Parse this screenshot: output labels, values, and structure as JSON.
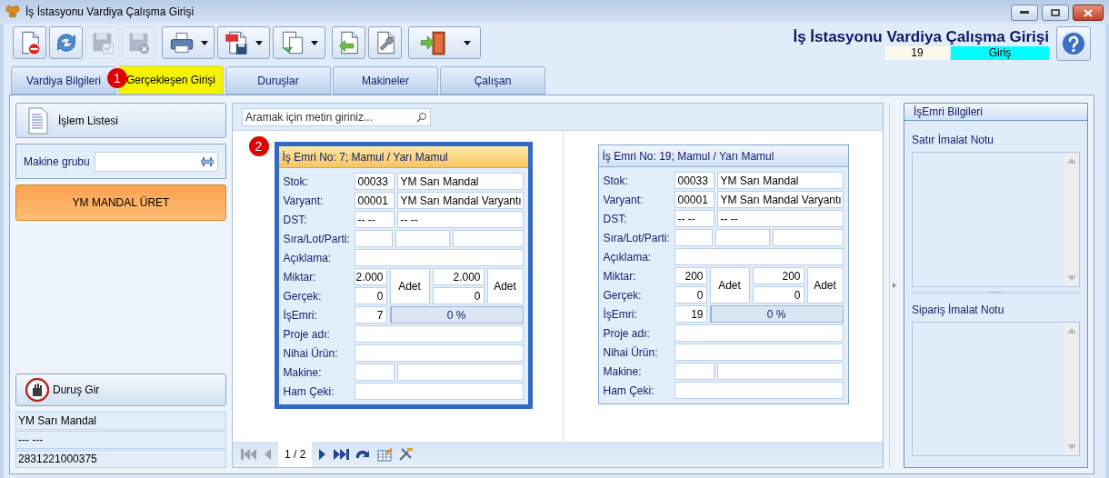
{
  "window": {
    "title": "İş İstasyonu Vardiya Çalışma Girişi"
  },
  "toolbar": [
    {
      "disabled": false,
      "dropdown": false
    },
    {
      "disabled": false,
      "dropdown": false
    },
    {
      "disabled": true,
      "dropdown": false
    },
    {
      "disabled": true,
      "dropdown": false
    },
    {
      "disabled": false,
      "dropdown": true
    },
    {
      "disabled": false,
      "dropdown": true
    },
    {
      "disabled": false,
      "dropdown": true
    },
    {
      "disabled": false,
      "dropdown": false
    },
    {
      "disabled": false,
      "dropdown": false
    },
    {
      "disabled": false,
      "dropdown": true
    }
  ],
  "header": {
    "heading": "İş İstasyonu Vardiya Çalışma Girişi",
    "record_no": "19",
    "mode": "Giriş"
  },
  "tabs": [
    {
      "label": "Vardiya Bilgileri",
      "selected": false
    },
    {
      "label": "Gerçekleşen Girişi",
      "selected": true,
      "marker": "1"
    },
    {
      "label": "Duruşlar",
      "selected": false
    },
    {
      "label": "Makineler",
      "selected": false
    },
    {
      "label": "Çalışan",
      "selected": false
    }
  ],
  "left_panel": {
    "list_button": "İşlem Listesi",
    "machine_group": {
      "label": "Makine grubu"
    },
    "action_button": "YM MANDAL ÜRET",
    "stop_button": "Duruş Gir",
    "info_lines": [
      "YM Sarı Mandal",
      "--- ---",
      "2831221000375"
    ]
  },
  "search": {
    "placeholder": "Aramak için metin giriniz..."
  },
  "cards": [
    {
      "title": "İş Emri No: 7; Mamul / Yarı Mamul",
      "selected": true,
      "marker": "2",
      "rows": [
        {
          "kind": "pair",
          "label": "Stok:",
          "values": [
            "00033",
            "YM Sarı Mandal"
          ]
        },
        {
          "kind": "pair",
          "label": "Varyant:",
          "values": [
            "00001",
            "YM Sarı Mandal Varyantı"
          ]
        },
        {
          "kind": "pair",
          "label": "DST:",
          "values": [
            "-- --",
            "-- --"
          ]
        },
        {
          "kind": "triple",
          "label": "Sıra/Lot/Parti:"
        },
        {
          "kind": "single",
          "label": "Açıklama:"
        },
        {
          "kind": "quantity",
          "labels": [
            "Miktar:",
            "Gerçek:"
          ],
          "planned": "2.000",
          "actual": "0",
          "unit": "Adet",
          "planned_2": "2.000",
          "actual_2": "0",
          "unit_2": "Adet"
        },
        {
          "kind": "progress",
          "label": "İşEmri:",
          "value": "7",
          "reading": "0 %",
          "level": 0
        },
        {
          "kind": "single",
          "label": "Proje adı:"
        },
        {
          "kind": "single",
          "label": "Nihai Ürün:"
        },
        {
          "kind": "pair",
          "label": "Makine:"
        },
        {
          "kind": "single",
          "label": "Ham Çeki:"
        }
      ]
    },
    {
      "title": "İş Emri No: 19; Mamul / Yarı Mamul",
      "selected": false,
      "rows": [
        {
          "kind": "pair",
          "label": "Stok:",
          "values": [
            "00033",
            "YM Sarı Mandal"
          ]
        },
        {
          "kind": "pair",
          "label": "Varyant:",
          "values": [
            "00001",
            "YM Sarı Mandal Varyantı"
          ]
        },
        {
          "kind": "pair",
          "label": "DST:",
          "values": [
            "-- --",
            "-- --"
          ]
        },
        {
          "kind": "triple",
          "label": "Sıra/Lot/Parti:"
        },
        {
          "kind": "single",
          "label": "Açıklama:"
        },
        {
          "kind": "quantity",
          "labels": [
            "Miktar:",
            "Gerçek:"
          ],
          "planned": "200",
          "actual": "0",
          "unit": "Adet",
          "planned_2": "200",
          "actual_2": "0",
          "unit_2": "Adet"
        },
        {
          "kind": "progress",
          "label": "İşEmri:",
          "value": "19",
          "reading": "0 %",
          "level": 0
        },
        {
          "kind": "single",
          "label": "Proje adı:"
        },
        {
          "kind": "single",
          "label": "Nihai Ürün:"
        },
        {
          "kind": "pair",
          "label": "Makine:"
        },
        {
          "kind": "single",
          "label": "Ham Çeki:"
        }
      ]
    }
  ],
  "pager": {
    "page": "1 / 2",
    "buttons": [
      {
        "disabled": true
      },
      {
        "disabled": true
      },
      {
        "disabled": false
      },
      {
        "disabled": false
      },
      {
        "disabled": false
      },
      {
        "disabled": false
      },
      {
        "disabled": false
      }
    ]
  },
  "right_panel": {
    "title": "İşEmri Bilgileri",
    "notes": [
      {
        "label": "Satır İmalat Notu"
      },
      {
        "label": "Sipariş İmalat Notu"
      }
    ]
  }
}
